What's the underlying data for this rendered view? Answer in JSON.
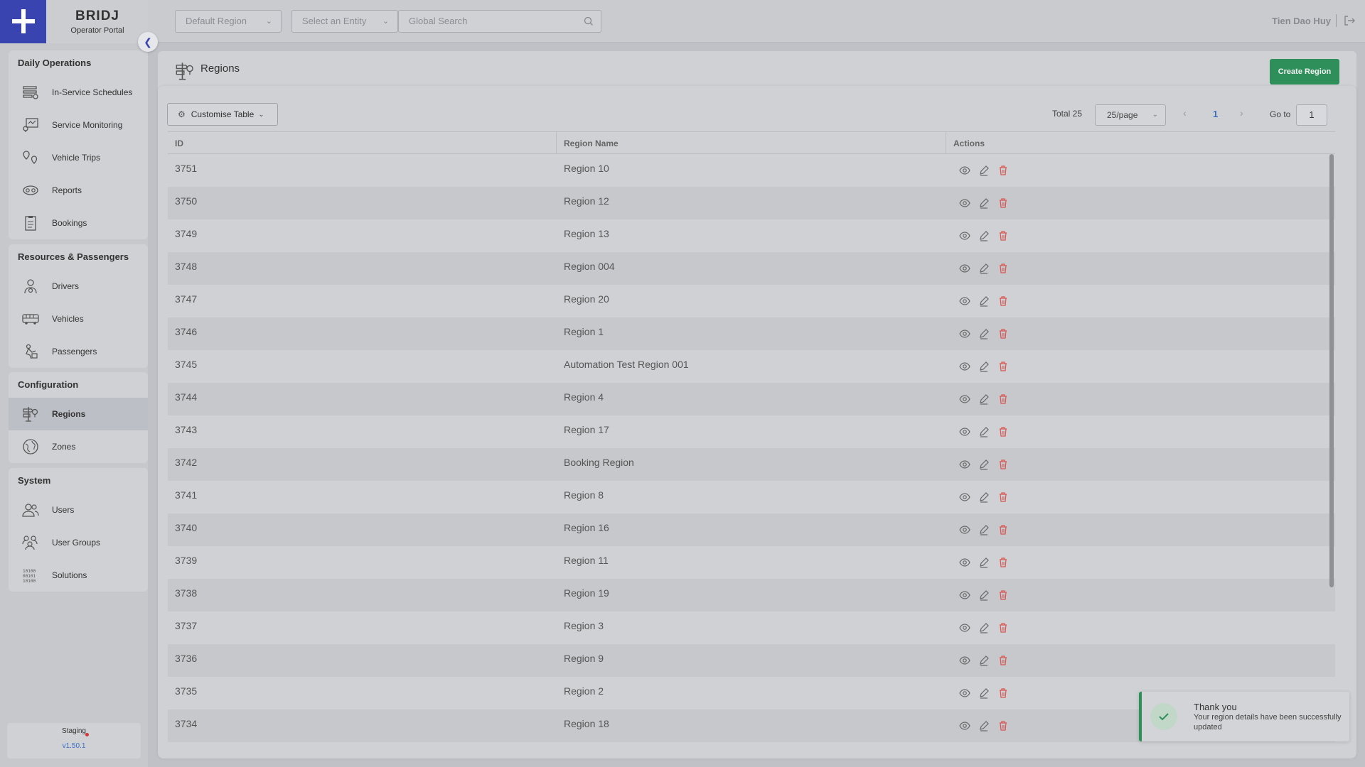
{
  "brand": {
    "name": "BRIDJ",
    "subtitle": "Operator Portal"
  },
  "sidebar": {
    "groups": [
      {
        "title": "Daily Operations",
        "items": [
          {
            "label": "In-Service Schedules",
            "icon": "schedule-icon"
          },
          {
            "label": "Service Monitoring",
            "icon": "monitoring-icon"
          },
          {
            "label": "Vehicle Trips",
            "icon": "trips-pin-icon"
          },
          {
            "label": "Reports",
            "icon": "reports-icon"
          },
          {
            "label": "Bookings",
            "icon": "bookings-clipboard-icon"
          }
        ]
      },
      {
        "title": "Resources & Passengers",
        "items": [
          {
            "label": "Drivers",
            "icon": "driver-icon"
          },
          {
            "label": "Vehicles",
            "icon": "bus-icon"
          },
          {
            "label": "Passengers",
            "icon": "passenger-icon"
          }
        ]
      },
      {
        "title": "Configuration",
        "items": [
          {
            "label": "Regions",
            "icon": "regions-signpost-icon",
            "active": true
          },
          {
            "label": "Zones",
            "icon": "zones-globe-icon"
          }
        ]
      },
      {
        "title": "System",
        "items": [
          {
            "label": "Users",
            "icon": "users-icon"
          },
          {
            "label": "User Groups",
            "icon": "user-groups-icon"
          },
          {
            "label": "Solutions",
            "icon": "binary-solutions-icon"
          }
        ]
      }
    ],
    "environment": {
      "name": "Staging",
      "version": "v1.50.1",
      "dot_color": "#d63838"
    }
  },
  "topbar": {
    "region_select": {
      "placeholder": "Default Region"
    },
    "entity_select": {
      "placeholder": "Select an Entity"
    },
    "search": {
      "placeholder": "Global Search"
    },
    "user_name": "Tien Dao Huy"
  },
  "page": {
    "title": "Regions",
    "create_button": "Create Region",
    "customise_button": "Customise Table"
  },
  "pagination": {
    "total_label": "Total 25",
    "page_size": "25/page",
    "current_page": "1",
    "goto_label": "Go to",
    "goto_value": "1"
  },
  "table": {
    "columns": [
      "ID",
      "Region Name",
      "Actions"
    ],
    "rows": [
      {
        "id": "3751",
        "name": "Region 10"
      },
      {
        "id": "3750",
        "name": "Region 12"
      },
      {
        "id": "3749",
        "name": "Region 13"
      },
      {
        "id": "3748",
        "name": "Region 004"
      },
      {
        "id": "3747",
        "name": "Region 20"
      },
      {
        "id": "3746",
        "name": "Region 1"
      },
      {
        "id": "3745",
        "name": "Automation Test Region 001"
      },
      {
        "id": "3744",
        "name": "Region 4"
      },
      {
        "id": "3743",
        "name": "Region 17"
      },
      {
        "id": "3742",
        "name": "Booking Region"
      },
      {
        "id": "3741",
        "name": "Region 8"
      },
      {
        "id": "3740",
        "name": "Region 16"
      },
      {
        "id": "3739",
        "name": "Region 11"
      },
      {
        "id": "3738",
        "name": "Region 19"
      },
      {
        "id": "3737",
        "name": "Region 3"
      },
      {
        "id": "3736",
        "name": "Region 9"
      },
      {
        "id": "3735",
        "name": "Region 2"
      },
      {
        "id": "3734",
        "name": "Region 18"
      }
    ]
  },
  "toast": {
    "title": "Thank you",
    "message": "Your region details have been successfully updated",
    "accent": "#2e8f5b"
  },
  "colors": {
    "brand": "#3a44b0",
    "primary_button": "#2e8f5b",
    "delete": "#d9534f",
    "link": "#3a6ec0"
  }
}
